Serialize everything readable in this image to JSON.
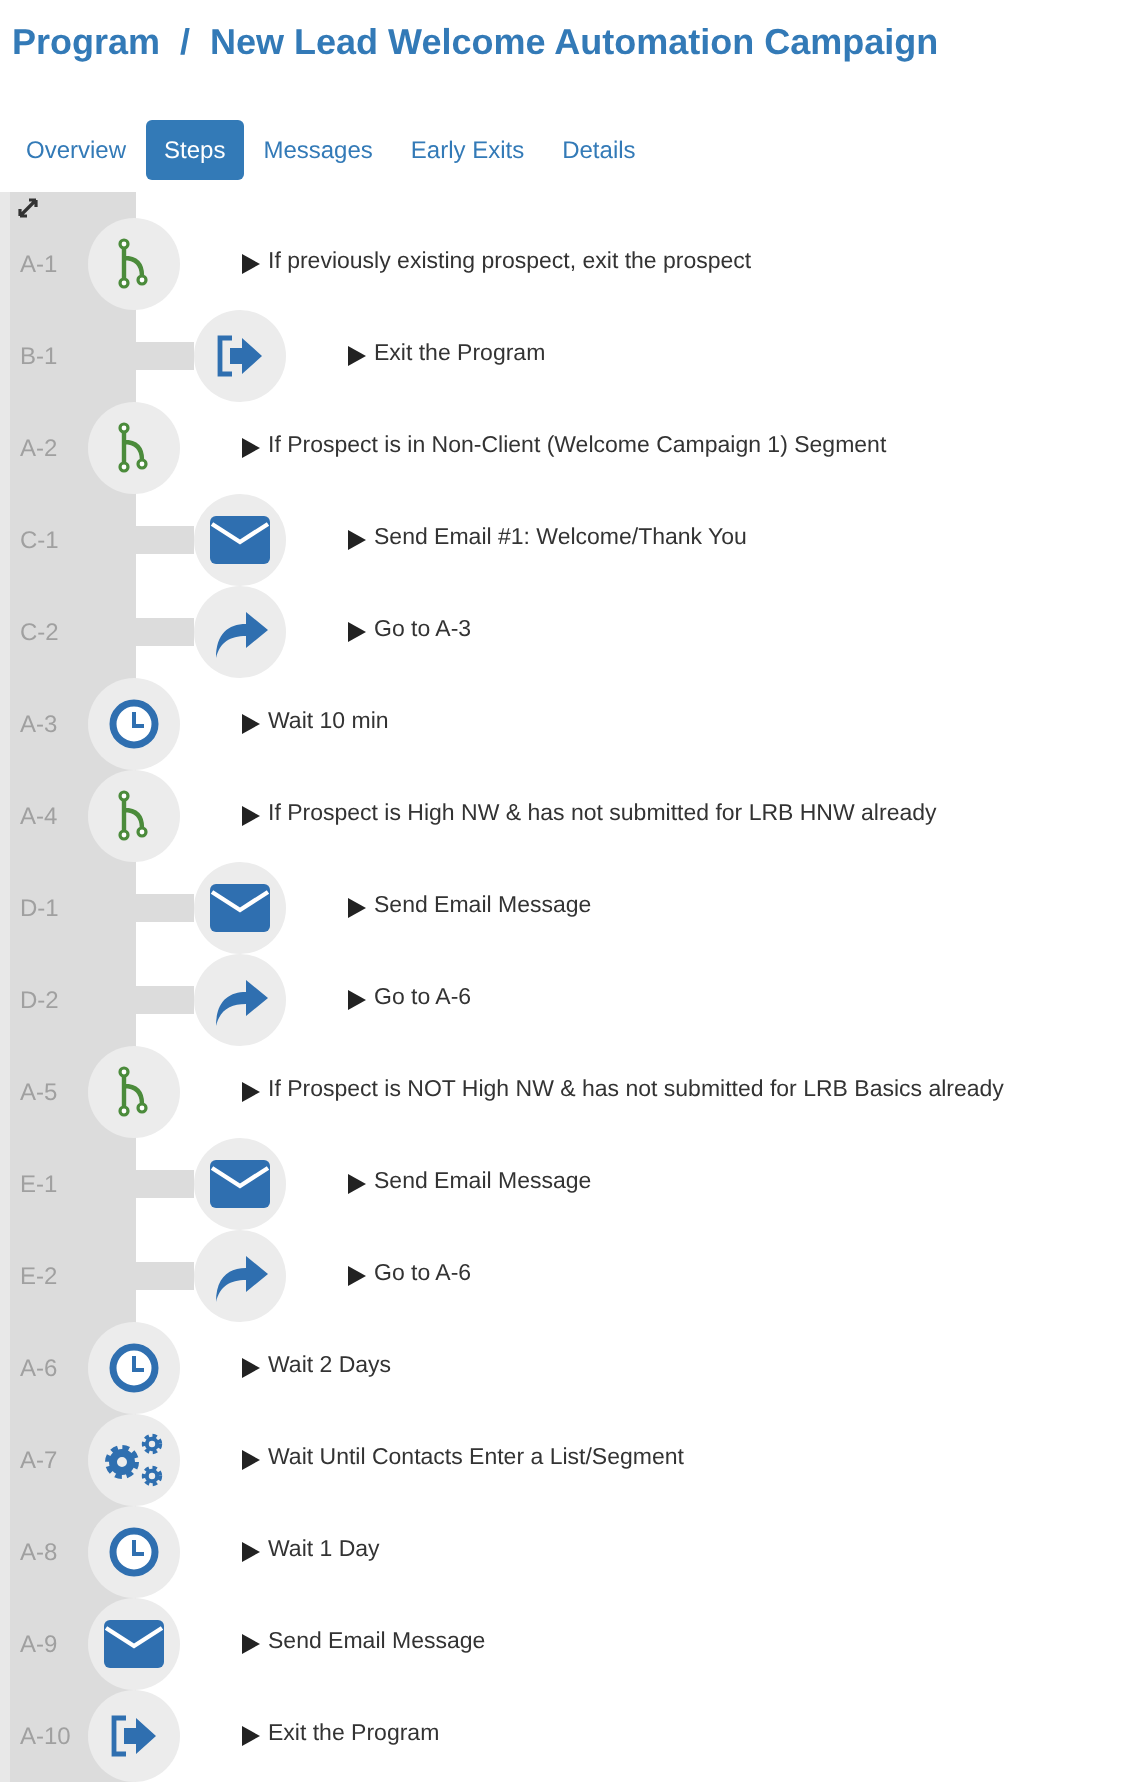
{
  "title": "Program  /  New Lead Welcome Automation Campaign",
  "tabs": [
    {
      "label": "Overview",
      "selected": false
    },
    {
      "label": "Steps",
      "selected": true
    },
    {
      "label": "Messages",
      "selected": false
    },
    {
      "label": "Early Exits",
      "selected": false
    },
    {
      "label": "Details",
      "selected": false
    }
  ],
  "steps": [
    {
      "id": "A-1",
      "kind": "branch",
      "text": "If previously existing prospect, exit the prospect",
      "children": [
        {
          "id": "B-1",
          "kind": "exit",
          "text": "Exit the Program"
        }
      ]
    },
    {
      "id": "A-2",
      "kind": "branch",
      "text": "If Prospect is in Non-Client (Welcome Campaign 1) Segment",
      "children": [
        {
          "id": "C-1",
          "kind": "email",
          "text": "Send Email #1: Welcome/Thank You"
        },
        {
          "id": "C-2",
          "kind": "goto",
          "text": "Go to A-3"
        }
      ]
    },
    {
      "id": "A-3",
      "kind": "wait",
      "text": "Wait 10 min"
    },
    {
      "id": "A-4",
      "kind": "branch",
      "text": "If Prospect is High NW & has not submitted for LRB HNW already",
      "children": [
        {
          "id": "D-1",
          "kind": "email",
          "text": "Send Email Message"
        },
        {
          "id": "D-2",
          "kind": "goto",
          "text": "Go to A-6"
        }
      ]
    },
    {
      "id": "A-5",
      "kind": "branch",
      "text": "If Prospect is NOT High NW & has not submitted for LRB Basics already",
      "children": [
        {
          "id": "E-1",
          "kind": "email",
          "text": "Send Email Message"
        },
        {
          "id": "E-2",
          "kind": "goto",
          "text": "Go to A-6"
        }
      ]
    },
    {
      "id": "A-6",
      "kind": "wait",
      "text": "Wait 2 Days"
    },
    {
      "id": "A-7",
      "kind": "wait_until",
      "text": "Wait Until Contacts Enter a List/Segment"
    },
    {
      "id": "A-8",
      "kind": "wait",
      "text": "Wait 1 Day"
    },
    {
      "id": "A-9",
      "kind": "email",
      "text": "Send Email Message"
    },
    {
      "id": "A-10",
      "kind": "exit",
      "text": "Exit the Program"
    }
  ]
}
